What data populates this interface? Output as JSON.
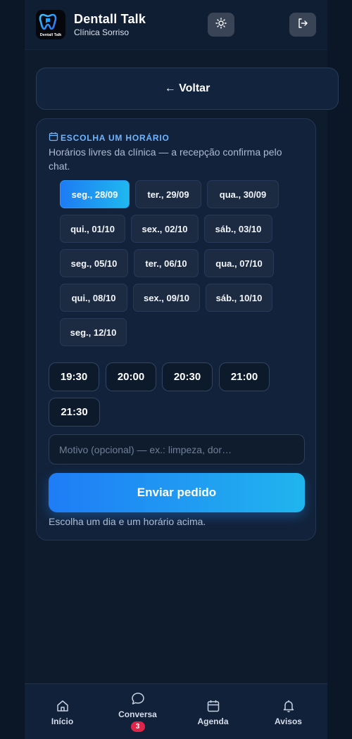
{
  "header": {
    "logo_text": "Dentall Talk",
    "title": "Dentall Talk",
    "subtitle": "Clínica Sorriso",
    "theme_icon": "sun-icon",
    "logout_icon": "logout-icon"
  },
  "back_button": {
    "label": "← Voltar"
  },
  "schedule": {
    "heading": "ESCOLHA UM HORÁRIO",
    "heading_icon": "calendar-icon",
    "description": "Horários livres da clínica — a recepção confirma pelo chat.",
    "dates": [
      {
        "label": "seg., 28/09",
        "selected": true
      },
      {
        "label": "ter., 29/09",
        "selected": false
      },
      {
        "label": "qua., 30/09",
        "selected": false
      },
      {
        "label": "qui., 01/10",
        "selected": false
      },
      {
        "label": "sex., 02/10",
        "selected": false
      },
      {
        "label": "sáb., 03/10",
        "selected": false
      },
      {
        "label": "seg., 05/10",
        "selected": false
      },
      {
        "label": "ter., 06/10",
        "selected": false
      },
      {
        "label": "qua., 07/10",
        "selected": false
      },
      {
        "label": "qui., 08/10",
        "selected": false
      },
      {
        "label": "sex., 09/10",
        "selected": false
      },
      {
        "label": "sáb., 10/10",
        "selected": false
      },
      {
        "label": "seg., 12/10",
        "selected": false
      }
    ],
    "times": [
      "19:30",
      "20:00",
      "20:30",
      "21:00",
      "21:30"
    ],
    "reason_placeholder": "Motivo (opcional) — ex.: limpeza, dor…",
    "reason_value": "",
    "submit_label": "Enviar pedido",
    "hint": "Escolha um dia e um horário acima."
  },
  "bottom_nav": {
    "items": [
      {
        "label": "Início",
        "icon": "home-icon"
      },
      {
        "label": "Conversa",
        "icon": "chat-icon",
        "badge": "3"
      },
      {
        "label": "Agenda",
        "icon": "calendar-icon"
      },
      {
        "label": "Avisos",
        "icon": "bell-icon"
      }
    ]
  },
  "colors": {
    "background": "#0b1727",
    "accent_start": "#1e7bf4",
    "accent_end": "#1fb8ef",
    "heading_blue": "#6fb5ff",
    "badge_red": "#e0254a"
  }
}
